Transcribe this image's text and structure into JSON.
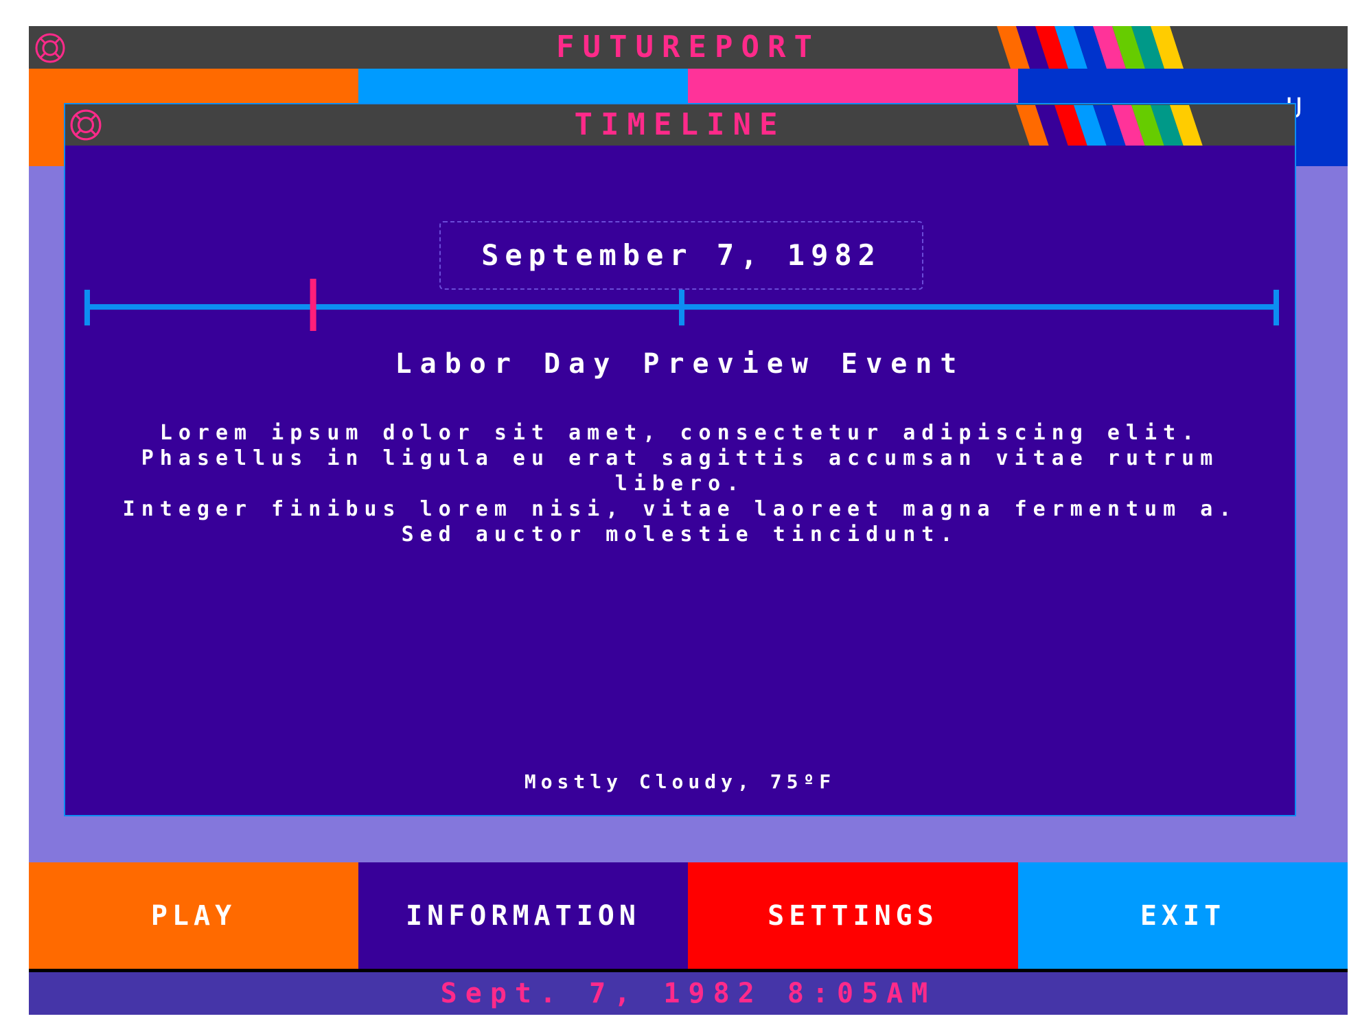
{
  "app": {
    "title": "FUTUREPORT",
    "hidden_nav_fragment": "U"
  },
  "modal": {
    "title": "TIMELINE",
    "date_label": "September 7, 1982",
    "timeline": {
      "current_position": 0.19,
      "midpoint_marker": 0.5
    },
    "event_title": "Labor Day Preview Event",
    "description_paragraphs": [
      "Lorem ipsum dolor sit amet, consectetur adipiscing elit. Phasellus in ligula eu erat sagittis accumsan vitae rutrum libero.",
      "Integer finibus lorem nisi, vitae laoreet magna fermentum a. Sed auctor molestie tincidunt."
    ],
    "weather": "Mostly Cloudy, 75ºF"
  },
  "buttons": {
    "play": "PLAY",
    "information": "INFORMATION",
    "settings": "SETTINGS",
    "exit": "EXIT"
  },
  "status": {
    "datetime": "Sept. 7, 1982 8:05AM"
  },
  "colors": {
    "titlebar_bg": "#424242",
    "title_pink": "#ff2a8a",
    "modal_bg": "#380099",
    "content_bg": "#8477dc",
    "timeline_blue": "#0d8ef2",
    "marker_pink": "#ff1f7a",
    "nav_orange": "#ff6a00",
    "nav_cyan": "#009bff",
    "nav_pink": "#ff3399",
    "nav_blue": "#0033cc",
    "btn_orange": "#ff6a00",
    "btn_purple": "#380099",
    "btn_red": "#ff0000",
    "btn_cyan": "#009bff",
    "status_bg": "#4535a8"
  },
  "icons": {
    "app_logo": "lifebuoy-icon",
    "modal_logo": "lifebuoy-icon"
  }
}
